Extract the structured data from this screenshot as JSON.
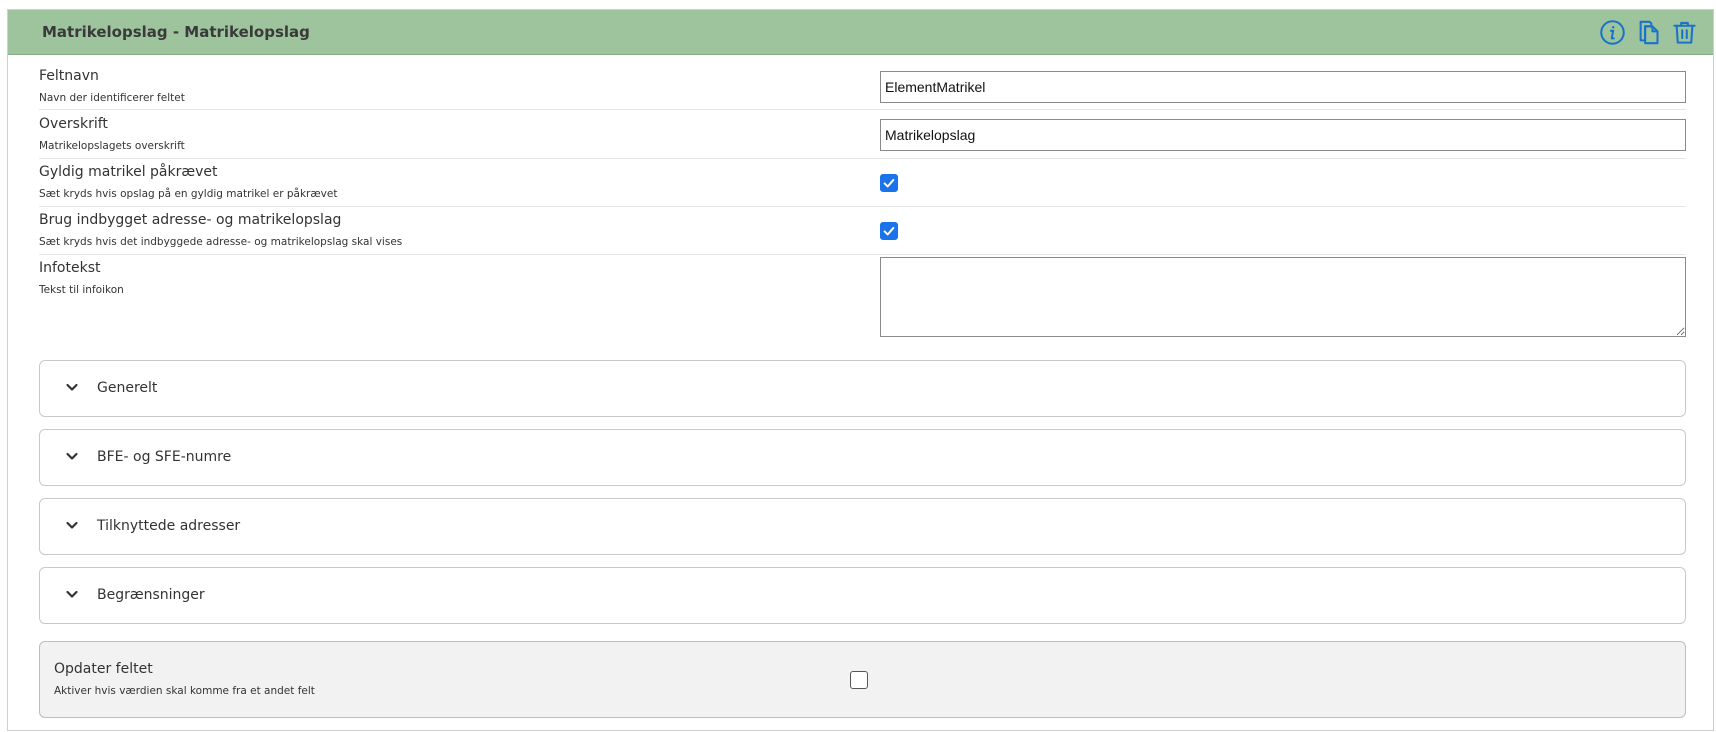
{
  "header": {
    "title": "Matrikelopslag - Matrikelopslag",
    "icons": [
      "info-icon",
      "copy-icon",
      "trash-icon"
    ],
    "icon_color": "#1a73c8",
    "background_color": "#9dc49d"
  },
  "fields": [
    {
      "label": "Feltnavn",
      "help": "Navn der identificerer feltet",
      "type": "text",
      "value": "ElementMatrikel"
    },
    {
      "label": "Overskrift",
      "help": "Matrikelopslagets overskrift",
      "type": "text",
      "value": "Matrikelopslag"
    },
    {
      "label": "Gyldig matrikel påkrævet",
      "help": "Sæt kryds hvis opslag på en gyldig matrikel er påkrævet",
      "type": "checkbox",
      "checked": true
    },
    {
      "label": "Brug indbygget adresse- og matrikelopslag",
      "help": "Sæt kryds hvis det indbyggede adresse- og matrikelopslag skal vises",
      "type": "checkbox",
      "checked": true
    },
    {
      "label": "Infotekst",
      "help": "Tekst til infoikon",
      "type": "textarea",
      "value": ""
    }
  ],
  "sections": [
    {
      "label": "Generelt"
    },
    {
      "label": "BFE- og SFE-numre"
    },
    {
      "label": "Tilknyttede adresser"
    },
    {
      "label": "Begrænsninger"
    }
  ],
  "update": {
    "label": "Opdater feltet",
    "help": "Aktiver hvis værdien skal komme fra et andet felt",
    "checked": false
  },
  "colors": {
    "checkbox_checked": "#1a73e8"
  }
}
